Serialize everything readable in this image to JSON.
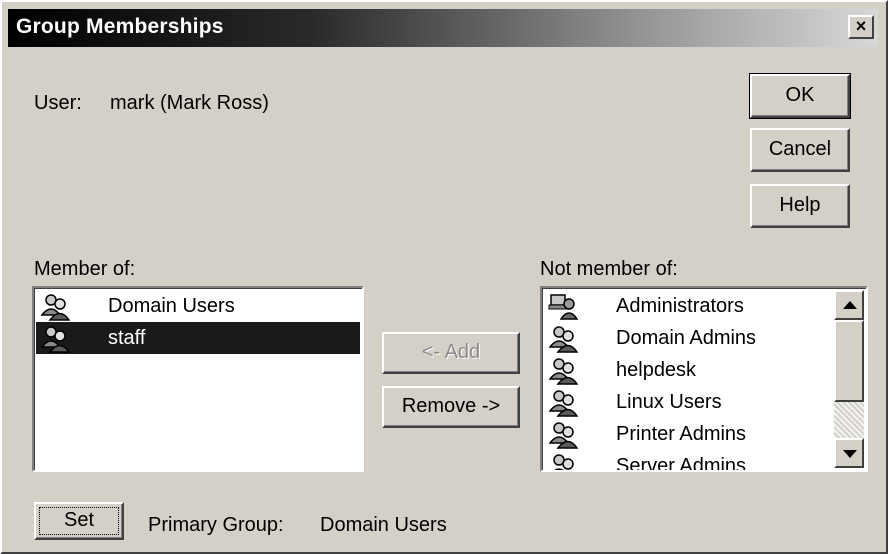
{
  "dialog": {
    "title": "Group Memberships",
    "close_glyph": "×"
  },
  "user": {
    "label": "User:",
    "value": "mark (Mark Ross)"
  },
  "buttons": {
    "ok": "OK",
    "cancel": "Cancel",
    "help": "Help",
    "add": "<- Add",
    "remove": "Remove ->",
    "set": "Set"
  },
  "member_of": {
    "label": "Member of:",
    "items": [
      {
        "name": "Domain Users",
        "icon": "group-icon",
        "selected": false
      },
      {
        "name": "staff",
        "icon": "group-icon",
        "selected": true
      }
    ]
  },
  "not_member_of": {
    "label": "Not member of:",
    "items": [
      {
        "name": "Administrators",
        "icon": "admin-group-icon"
      },
      {
        "name": "Domain Admins",
        "icon": "group-icon"
      },
      {
        "name": "helpdesk",
        "icon": "group-icon"
      },
      {
        "name": "Linux Users",
        "icon": "group-icon"
      },
      {
        "name": "Printer Admins",
        "icon": "group-icon"
      },
      {
        "name": "Server Admins",
        "icon": "group-icon"
      }
    ]
  },
  "primary_group": {
    "label": "Primary Group:",
    "value": "Domain Users"
  },
  "colors": {
    "face": "#d4d0c8",
    "selection": "#1a1a1a"
  }
}
